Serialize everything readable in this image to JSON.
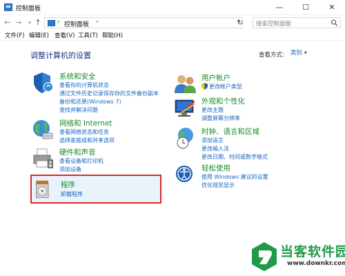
{
  "window": {
    "title": "控制面板",
    "minimize_glyph": "—",
    "maximize_glyph": "☐",
    "close_glyph": "✕"
  },
  "nav": {
    "back_glyph": "←",
    "forward_glyph": "→",
    "recent_glyph": "▾",
    "up_glyph": "↑",
    "refresh_glyph": "↻"
  },
  "address": {
    "separator": "›",
    "crumb": "控制面板",
    "dropdown_glyph": "▾"
  },
  "search": {
    "placeholder": "搜索控制面板"
  },
  "menu": {
    "items": [
      "文件(F)",
      "编辑(E)",
      "查看(V)",
      "工具(T)",
      "帮助(H)"
    ]
  },
  "page": {
    "title": "调整计算机的设置",
    "view_by_label": "查看方式:",
    "view_by_value": "类别 ▾"
  },
  "categories": {
    "system_security": {
      "title": "系统和安全",
      "links": [
        "查看你的计算机状态",
        "通过文件历史记录保存你的文件备份副本",
        "备份和还原(Windows 7)",
        "查找并解决问题"
      ]
    },
    "network": {
      "title": "网络和 Internet",
      "links": [
        "查看网络状态和任务",
        "选择家庭组和共享选项"
      ]
    },
    "hardware": {
      "title": "硬件和声音",
      "links": [
        "查看设备和打印机",
        "添加设备"
      ]
    },
    "programs": {
      "title": "程序",
      "links": [
        "卸载程序"
      ]
    },
    "user_accounts": {
      "title": "用户帐户",
      "links": [
        "更改帐户类型"
      ]
    },
    "appearance": {
      "title": "外观和个性化",
      "links": [
        "更改主题",
        "调整屏幕分辨率"
      ]
    },
    "clock_region": {
      "title": "时钟、语言和区域",
      "links": [
        "添加语言",
        "更改输入法",
        "更改日期、时间或数字格式"
      ]
    },
    "ease_of_access": {
      "title": "轻松使用",
      "links": [
        "使用 Windows 建议的设置",
        "优化视觉显示"
      ]
    }
  },
  "watermark": {
    "title": "当客软件园",
    "url": "www.downkr.com"
  },
  "colors": {
    "category_title": "#1a8a2a",
    "link": "#1565c0",
    "page_title": "#1e3287",
    "highlight_border": "#d02b27"
  }
}
